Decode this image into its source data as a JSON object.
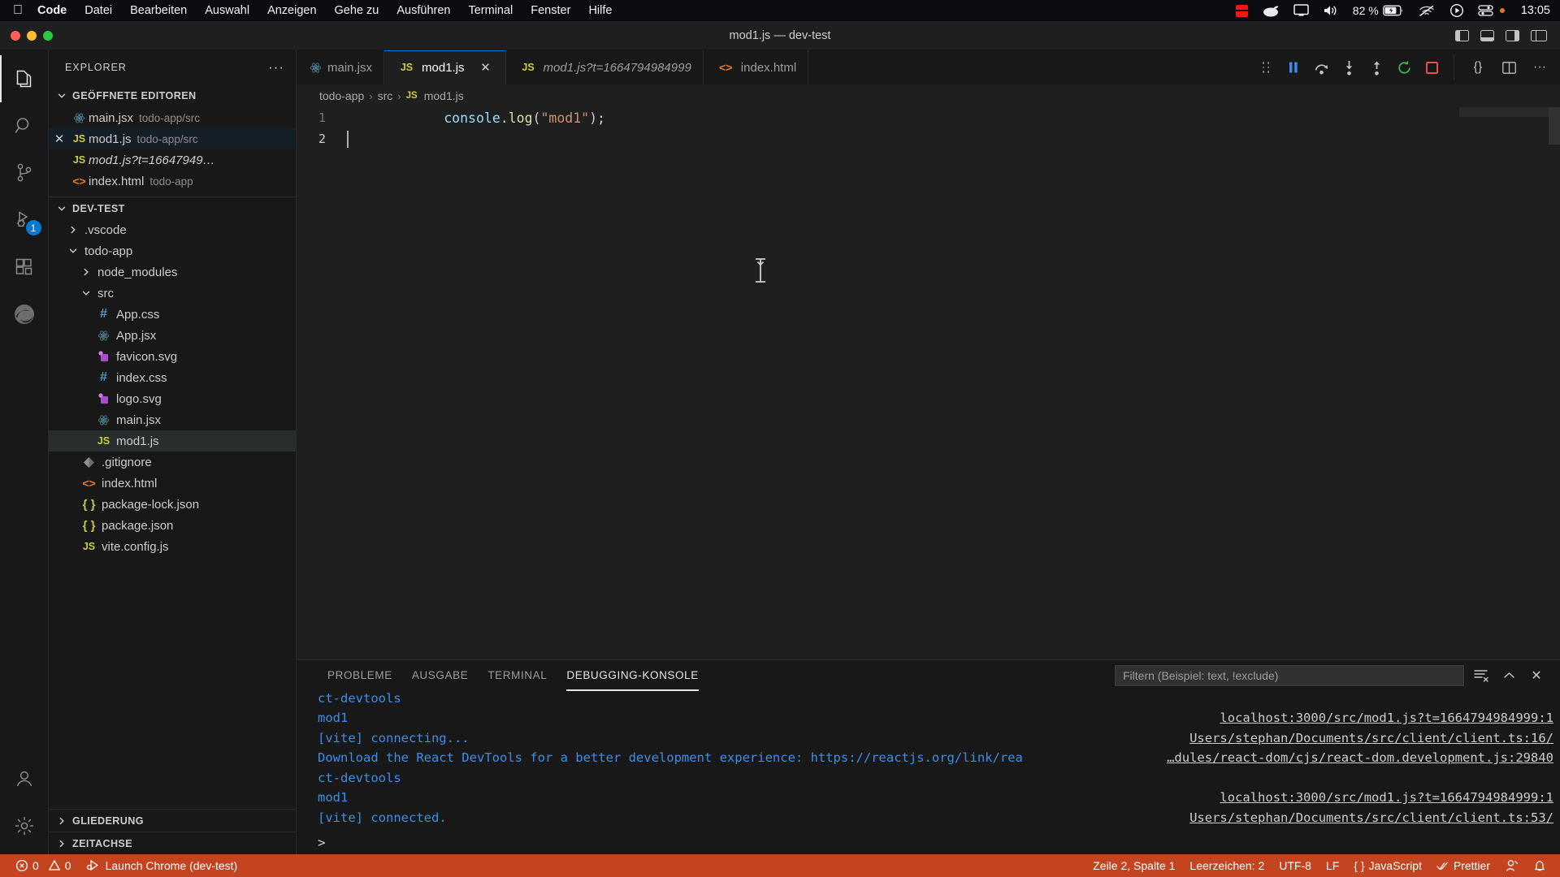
{
  "macos_menubar": {
    "apple_icon": "apple-icon",
    "items": [
      {
        "label": "Code",
        "bold": true
      },
      {
        "label": "Datei",
        "bold": false
      },
      {
        "label": "Bearbeiten",
        "bold": false
      },
      {
        "label": "Auswahl",
        "bold": false
      },
      {
        "label": "Anzeigen",
        "bold": false
      },
      {
        "label": "Gehe zu",
        "bold": false
      },
      {
        "label": "Ausführen",
        "bold": false
      },
      {
        "label": "Terminal",
        "bold": false
      },
      {
        "label": "Fenster",
        "bold": false
      },
      {
        "label": "Hilfe",
        "bold": false
      }
    ],
    "status_icons": [
      "screen-recording-icon",
      "wacom-icon",
      "display-icon",
      "volume-icon",
      "wifi-icon",
      "control-center-icon",
      "spotlight-icon"
    ],
    "battery_percent": "82 %",
    "clock": "13:05"
  },
  "titlebar": {
    "title": "mod1.js — dev-test",
    "traffic_lights": [
      "close-button",
      "minimize-button",
      "maximize-button"
    ],
    "layout_buttons": [
      "toggle-primary-sidebar-icon",
      "toggle-panel-icon",
      "toggle-secondary-sidebar-icon",
      "customize-layout-icon"
    ]
  },
  "activitybar": {
    "items": [
      {
        "name": "explorer",
        "icon": "files-icon",
        "active": true,
        "badge": null
      },
      {
        "name": "search",
        "icon": "search-icon",
        "active": false,
        "badge": null
      },
      {
        "name": "source-control",
        "icon": "source-control-icon",
        "active": false,
        "badge": null
      },
      {
        "name": "run-and-debug",
        "icon": "run-debug-icon",
        "active": false,
        "badge": "1"
      },
      {
        "name": "extensions",
        "icon": "extensions-icon",
        "active": false,
        "badge": null
      },
      {
        "name": "browser-preview",
        "icon": "edge-icon",
        "active": false,
        "badge": null
      }
    ],
    "bottom_items": [
      {
        "name": "accounts",
        "icon": "account-icon"
      },
      {
        "name": "manage",
        "icon": "gear-icon"
      }
    ]
  },
  "sidebar": {
    "title": "EXPLORER",
    "more_actions": "···",
    "open_editors": {
      "label": "GEÖFFNETE EDITOREN",
      "expanded": true,
      "items": [
        {
          "name": "main.jsx",
          "desc": "todo-app/src",
          "icon": "react-icon",
          "italic": false,
          "close": false,
          "state": "none"
        },
        {
          "name": "mod1.js",
          "desc": "todo-app/src",
          "icon": "js-icon",
          "italic": false,
          "close": true,
          "state": "focused"
        },
        {
          "name": "mod1.js?t=16647949…",
          "desc": "",
          "icon": "js-icon",
          "italic": true,
          "close": false,
          "state": "none"
        },
        {
          "name": "index.html",
          "desc": "todo-app",
          "icon": "html-icon",
          "italic": false,
          "close": false,
          "state": "none"
        }
      ]
    },
    "workspace": {
      "label": "DEV-TEST",
      "expanded": true,
      "tree": [
        {
          "name": ".vscode",
          "type": "folder",
          "expanded": false,
          "depth": 1,
          "icon": "chevron-right-icon"
        },
        {
          "name": "todo-app",
          "type": "folder",
          "expanded": true,
          "depth": 1,
          "icon": "chevron-down-icon"
        },
        {
          "name": "node_modules",
          "type": "folder",
          "expanded": false,
          "depth": 2,
          "icon": "chevron-right-icon"
        },
        {
          "name": "src",
          "type": "folder",
          "expanded": true,
          "depth": 2,
          "icon": "chevron-down-icon"
        },
        {
          "name": "App.css",
          "type": "file",
          "depth": 3,
          "icon": "css-icon"
        },
        {
          "name": "App.jsx",
          "type": "file",
          "depth": 3,
          "icon": "react-icon"
        },
        {
          "name": "favicon.svg",
          "type": "file",
          "depth": 3,
          "icon": "svg-icon"
        },
        {
          "name": "index.css",
          "type": "file",
          "depth": 3,
          "icon": "css-icon"
        },
        {
          "name": "logo.svg",
          "type": "file",
          "depth": 3,
          "icon": "svg-icon"
        },
        {
          "name": "main.jsx",
          "type": "file",
          "depth": 3,
          "icon": "react-icon"
        },
        {
          "name": "mod1.js",
          "type": "file",
          "depth": 3,
          "icon": "js-icon",
          "selected": true
        },
        {
          "name": ".gitignore",
          "type": "file",
          "depth": 2,
          "icon": "git-icon"
        },
        {
          "name": "index.html",
          "type": "file",
          "depth": 2,
          "icon": "html-icon"
        },
        {
          "name": "package-lock.json",
          "type": "file",
          "depth": 2,
          "icon": "json-icon"
        },
        {
          "name": "package.json",
          "type": "file",
          "depth": 2,
          "icon": "json-icon"
        },
        {
          "name": "vite.config.js",
          "type": "file",
          "depth": 2,
          "icon": "js-icon"
        }
      ]
    },
    "collapsed_sections": [
      {
        "label": "GLIEDERUNG"
      },
      {
        "label": "ZEITACHSE"
      }
    ]
  },
  "editor": {
    "tabs": [
      {
        "label": "main.jsx",
        "icon": "react-icon",
        "active": false,
        "italic": false,
        "close": false
      },
      {
        "label": "mod1.js",
        "icon": "js-icon",
        "active": true,
        "italic": false,
        "close": true
      },
      {
        "label": "mod1.js?t=1664794984999",
        "icon": "js-icon",
        "active": false,
        "italic": true,
        "close": false
      },
      {
        "label": "index.html",
        "icon": "html-icon",
        "active": false,
        "italic": false,
        "close": false
      }
    ],
    "debug_toolbar": [
      {
        "name": "drag-handle-icon"
      },
      {
        "name": "pause-icon"
      },
      {
        "name": "step-over-icon"
      },
      {
        "name": "step-into-icon"
      },
      {
        "name": "step-out-icon"
      },
      {
        "name": "restart-icon"
      },
      {
        "name": "stop-icon"
      }
    ],
    "editor_actions": [
      {
        "name": "run-icon",
        "glyph": "{}"
      },
      {
        "name": "split-editor-icon"
      },
      {
        "name": "more-actions-icon",
        "glyph": "···"
      }
    ],
    "breadcrumb": [
      "todo-app",
      "src",
      "mod1.js"
    ],
    "breadcrumb_separator": "›",
    "code_lines": [
      {
        "num": "1",
        "tokens": [
          {
            "t": "console",
            "c": "c-var"
          },
          {
            "t": ".",
            "c": "c-punc"
          },
          {
            "t": "log",
            "c": "c-fn"
          },
          {
            "t": "(",
            "c": "c-punc"
          },
          {
            "t": "\"mod1\"",
            "c": "c-str"
          },
          {
            "t": ")",
            "c": "c-punc"
          },
          {
            "t": ";",
            "c": "c-punc"
          }
        ]
      },
      {
        "num": "2",
        "tokens": [],
        "cursor": true
      }
    ]
  },
  "panel": {
    "tabs": [
      {
        "label": "PROBLEME",
        "active": false
      },
      {
        "label": "AUSGABE",
        "active": false
      },
      {
        "label": "TERMINAL",
        "active": false
      },
      {
        "label": "DEBUGGING-KONSOLE",
        "active": true
      }
    ],
    "filter_placeholder": "Filtern (Beispiel: text, !exclude)",
    "filter_value": "",
    "actions": [
      {
        "name": "clear-console-icon"
      },
      {
        "name": "maximize-panel-icon",
        "glyph": "⌃"
      },
      {
        "name": "close-panel-icon",
        "glyph": "✕"
      }
    ],
    "console_lines": [
      {
        "text": "ct-devtools",
        "source": ""
      },
      {
        "text": "mod1",
        "source": "localhost:3000/src/mod1.js?t=1664794984999:1"
      },
      {
        "text": "[vite] connecting...",
        "source": "Users/stephan/Documents/src/client/client.ts:16/"
      },
      {
        "text": "Download the React DevTools for a better development experience: https://reactjs.org/link/rea",
        "source": "…dules/react-dom/cjs/react-dom.development.js:29840"
      },
      {
        "text": "ct-devtools",
        "source": ""
      },
      {
        "text": "mod1",
        "source": "localhost:3000/src/mod1.js?t=1664794984999:1"
      },
      {
        "text": "[vite] connected.",
        "source": "Users/stephan/Documents/src/client/client.ts:53/"
      }
    ],
    "input_prompt": ">"
  },
  "statusbar": {
    "background": "#c4441f",
    "left": [
      {
        "name": "problems",
        "icon": "error-icon",
        "errors": "0",
        "warn_icon": "warning-icon",
        "warnings": "0"
      },
      {
        "name": "debug-launch",
        "icon": "run-icon",
        "label": "Launch Chrome (dev-test)"
      }
    ],
    "right": [
      {
        "name": "cursor-position",
        "label": "Zeile 2, Spalte 1"
      },
      {
        "name": "indentation",
        "label": "Leerzeichen: 2"
      },
      {
        "name": "encoding",
        "label": "UTF-8"
      },
      {
        "name": "eol",
        "label": "LF"
      },
      {
        "name": "language-mode",
        "label": "JavaScript",
        "icon": "json-braces-icon"
      },
      {
        "name": "prettier",
        "label": "Prettier",
        "icon": "check-icon"
      },
      {
        "name": "feedback",
        "label": "",
        "icon": "feedback-icon"
      },
      {
        "name": "notifications",
        "label": "",
        "icon": "bell-icon"
      }
    ]
  }
}
